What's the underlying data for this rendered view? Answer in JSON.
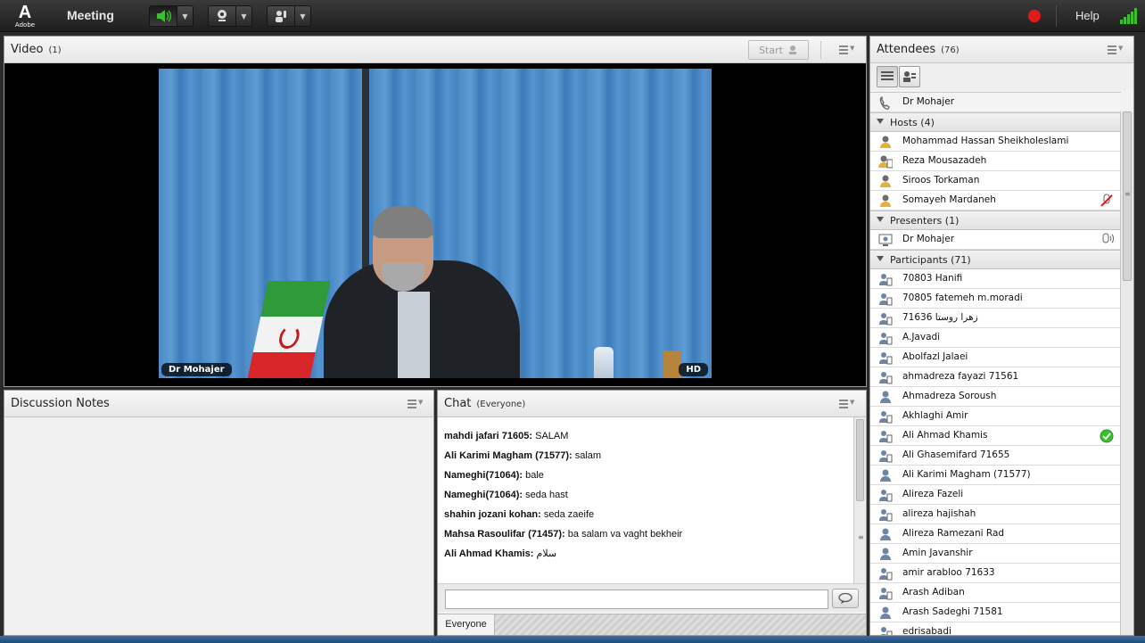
{
  "topbar": {
    "adobe_label": "Adobe",
    "menu_meeting": "Meeting",
    "help": "Help"
  },
  "video_pod": {
    "title": "Video",
    "count": "(1)",
    "start_label": "Start",
    "presenter_label": "Dr Mohajer",
    "hd_label": "HD"
  },
  "discussion_pod": {
    "title": "Discussion Notes"
  },
  "chat_pod": {
    "title": "Chat",
    "scope": "(Everyone)",
    "messages": [
      {
        "sender": "mahdi jafari 71605:",
        "text": " SALAM"
      },
      {
        "sender": "Ali Karimi Magham (71577):",
        "text": " salam"
      },
      {
        "sender": "Nameghi(71064):",
        "text": " bale"
      },
      {
        "sender": "Nameghi(71064):",
        "text": " seda hast"
      },
      {
        "sender": "shahin jozani kohan:",
        "text": " seda zaeife"
      },
      {
        "sender": "Mahsa Rasoulifar (71457):",
        "text": " ba salam va vaght bekheir"
      },
      {
        "sender": "Ali Ahmad Khamis:",
        "text": " سلام"
      }
    ],
    "input_value": "",
    "tab_label": "Everyone"
  },
  "attendees_pod": {
    "title": "Attendees",
    "count": "(76)",
    "caller": "Dr Mohajer",
    "groups": {
      "hosts": {
        "label": "Hosts (4)",
        "members": [
          "Mohammad Hassan Sheikholeslami",
          " Reza Mousazadeh",
          "Siroos Torkaman",
          "Somayeh Mardaneh"
        ]
      },
      "presenters": {
        "label": "Presenters (1)",
        "members": [
          "Dr Mohajer"
        ]
      },
      "participants": {
        "label": "Participants (71)",
        "members": [
          "70803 Hanifi",
          "70805  fatemeh m.moradi",
          "71636 زهرا روستا",
          "A.Javadi",
          "Abolfazl Jalaei",
          "ahmadreza fayazi 71561",
          "Ahmadreza Soroush",
          "Akhlaghi Amir",
          "Ali Ahmad Khamis",
          "Ali Ghasemifard 71655",
          "Ali Karimi Magham (71577)",
          "Alireza Fazeli",
          "alireza hajishah",
          "Alireza Ramezani Rad",
          "Amin Javanshir",
          "amir arabloo 71633",
          "Arash Adiban",
          "Arash Sadeghi 71581",
          "edrisabadi"
        ]
      }
    }
  },
  "colors": {
    "record": "#e01b1b",
    "speaker_active": "#3bbf2e",
    "status_ok": "#3bbf2e"
  },
  "icons": [
    "adobe-logo",
    "speaker-icon",
    "webcam-icon",
    "hand-raise-icon",
    "record-icon",
    "signal-icon",
    "pod-menu-icon",
    "send-icon",
    "list-view-icon",
    "card-view-icon",
    "phone-icon",
    "host-icon",
    "presenter-icon",
    "participant-icon",
    "mic-icon",
    "check-icon"
  ]
}
